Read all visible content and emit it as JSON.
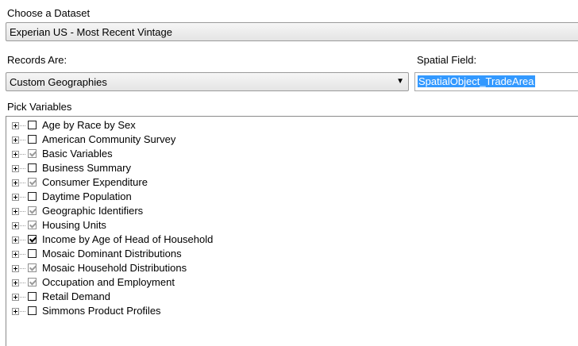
{
  "dataset": {
    "label": "Choose a Dataset",
    "value": "Experian US - Most Recent Vintage"
  },
  "records": {
    "label": "Records Are:",
    "value": "Custom Geographies"
  },
  "spatial_field": {
    "label": "Spatial Field:",
    "value": "SpatialObject_TradeArea"
  },
  "variables": {
    "label": "Pick Variables",
    "items": [
      {
        "label": "Age by Race by Sex",
        "state": "unchecked"
      },
      {
        "label": "American Community Survey",
        "state": "unchecked"
      },
      {
        "label": "Basic Variables",
        "state": "partial"
      },
      {
        "label": "Business Summary",
        "state": "unchecked"
      },
      {
        "label": "Consumer Expenditure",
        "state": "partial"
      },
      {
        "label": "Daytime Population",
        "state": "unchecked"
      },
      {
        "label": "Geographic Identifiers",
        "state": "partial"
      },
      {
        "label": "Housing Units",
        "state": "partial"
      },
      {
        "label": "Income by Age of Head of Household",
        "state": "checked"
      },
      {
        "label": "Mosaic Dominant Distributions",
        "state": "unchecked"
      },
      {
        "label": "Mosaic Household Distributions",
        "state": "partial"
      },
      {
        "label": "Occupation and Employment",
        "state": "partial"
      },
      {
        "label": "Retail Demand",
        "state": "unchecked"
      },
      {
        "label": "Simmons Product Profiles",
        "state": "unchecked"
      }
    ]
  }
}
